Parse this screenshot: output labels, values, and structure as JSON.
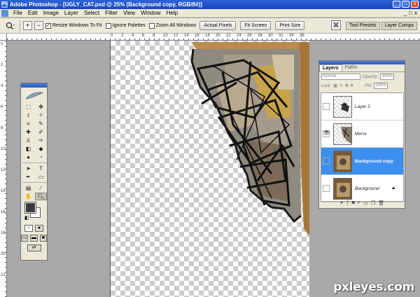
{
  "window": {
    "title": "Adobe Photoshop - [UGLY_CAT.psd @ 25% (Background copy, RGB/8#)]",
    "controls": [
      "_",
      "□",
      "x"
    ]
  },
  "menubar": {
    "items": [
      "File",
      "Edit",
      "Image",
      "Layer",
      "Select",
      "Filter",
      "View",
      "Window",
      "Help"
    ],
    "mdi_controls": [
      "_",
      "□",
      "x"
    ]
  },
  "options": {
    "zoom_in": "+",
    "zoom_out": "−",
    "resize_windows_label": "Resize Windows To Fit",
    "resize_windows_checked": true,
    "ignore_palettes_label": "Ignore Palettes",
    "ignore_palettes_checked": false,
    "zoom_all_label": "Zoom All Windows",
    "zoom_all_checked": false,
    "actual_pixels": "Actual Pixels",
    "fit_screen": "Fit Screen",
    "print_size": "Print Size"
  },
  "wells": {
    "tool_presets": "Tool Presets",
    "layer_comps": "Layer Comps"
  },
  "rulers": {
    "top_numbers": [
      "0",
      "2",
      "4",
      "6",
      "8",
      "10",
      "12",
      "14",
      "16",
      "18",
      "20",
      "22",
      "24",
      "26",
      "28",
      "30",
      "32",
      "34",
      "36"
    ],
    "left_numbers": [
      "0",
      "2",
      "4",
      "6",
      "8",
      "10",
      "12",
      "14",
      "16",
      "18",
      "20",
      "22"
    ]
  },
  "layers_panel": {
    "tabs": [
      "Layers",
      "Paths"
    ],
    "blend_mode": "Normal",
    "opacity_label": "Opacity:",
    "opacity_value": "100%",
    "lock_label": "Lock:",
    "fill_label": "Fill:",
    "fill_value": "100%",
    "layers": [
      {
        "name": "Layer 2",
        "visible": false,
        "selected": false,
        "locked": false
      },
      {
        "name": "Mirror",
        "visible": true,
        "selected": false,
        "locked": false
      },
      {
        "name": "Background copy",
        "visible": false,
        "selected": true,
        "locked": false
      },
      {
        "name": "Background",
        "visible": false,
        "selected": false,
        "locked": true
      }
    ]
  },
  "watermark": "pxleyes.com"
}
